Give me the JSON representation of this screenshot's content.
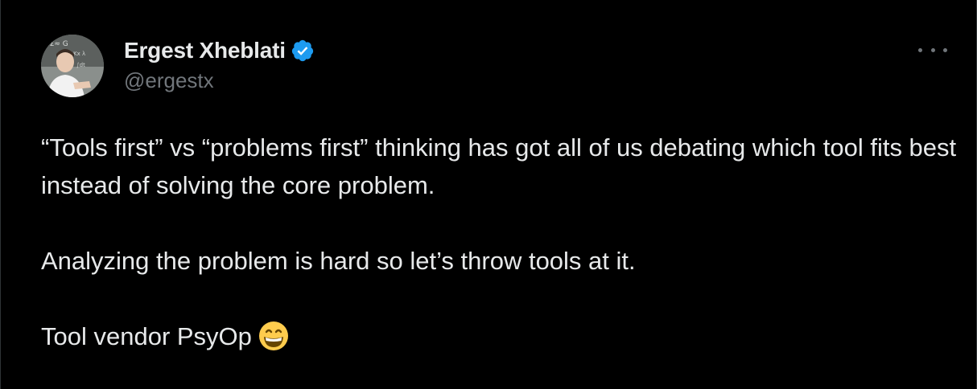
{
  "author": {
    "display_name": "Ergest Xheblati",
    "handle": "@ergestx",
    "verified_icon": "verified-badge-icon",
    "avatar_icon": "avatar-photo"
  },
  "tweet": {
    "line1": "“Tools first” vs “problems first” thinking has got all of us debating which tool fits best instead of solving the core problem.",
    "line2": "Analyzing the problem is hard so let’s throw tools at it.",
    "line3": "Tool vendor PsyOp",
    "emoji": "grinning-face-with-smiling-eyes"
  },
  "actions": {
    "more_icon": "more-options-icon"
  },
  "colors": {
    "background": "#000000",
    "text": "#e7e9ea",
    "muted": "#71767b",
    "verified": "#1d9bf0"
  }
}
